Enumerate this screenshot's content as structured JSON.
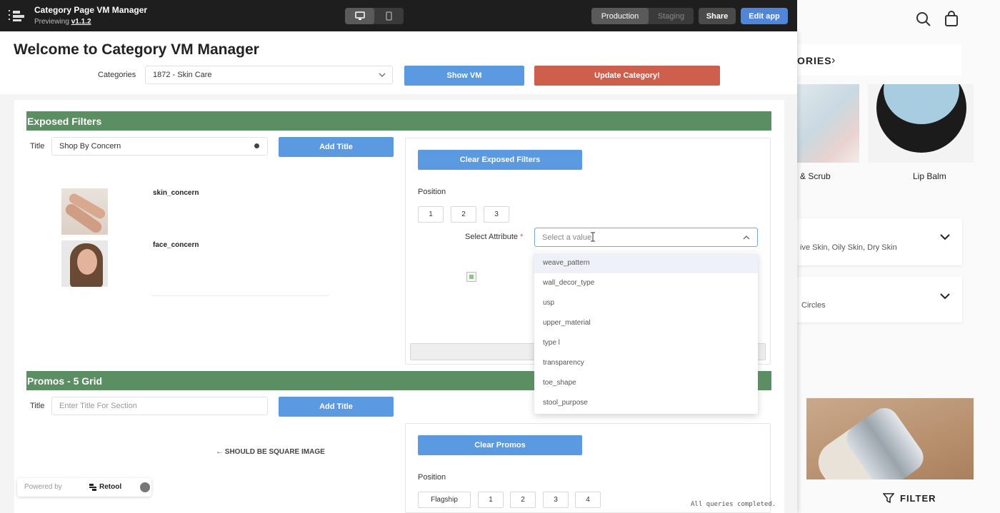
{
  "header": {
    "app_title": "Category Page VM Manager",
    "preview_prefix": "Previewing",
    "version": "v1.1.2",
    "env_production": "Production",
    "env_staging": "Staging",
    "share_label": "Share",
    "edit_label": "Edit app"
  },
  "page": {
    "title": "Welcome to Category VM Manager",
    "categories_label": "Categories",
    "category_value": "1872 - Skin Care",
    "show_vm_label": "Show VM",
    "update_category_label": "Update Category!"
  },
  "exposed_filters": {
    "section_title": "Exposed Filters",
    "title_label": "Title",
    "title_value": "Shop By Concern",
    "add_title_label": "Add Title",
    "items": [
      {
        "name": "skin_concern"
      },
      {
        "name": "face_concern"
      }
    ],
    "clear_label": "Clear Exposed Filters",
    "position_label": "Position",
    "positions": [
      "1",
      "2",
      "3"
    ],
    "select_attribute_label": "Select Attribute",
    "required_mark": "*",
    "select_placeholder": "Select a value",
    "dropdown_options": [
      "weave_pattern",
      "wall_decor_type",
      "usp",
      "upper_material",
      "type l",
      "transparency",
      "toe_shape",
      "stool_purpose"
    ]
  },
  "promos": {
    "section_title": "Promos - 5 Grid",
    "title_label": "Title",
    "title_placeholder": "Enter Title For Section",
    "add_title_label": "Add Title",
    "square_note": "← SHOULD BE SQUARE IMAGE",
    "clear_label": "Clear Promos",
    "position_label": "Position",
    "positions": [
      "Flagship",
      "1",
      "2",
      "3",
      "4"
    ]
  },
  "footer": {
    "powered_by": "Powered by",
    "brand": "Retool",
    "status": "All queries completed."
  },
  "storefront": {
    "categories_fragment": "ORIES",
    "product_labels": [
      "& Scrub",
      "Lip Balm"
    ],
    "accordion_1": "ive Skin, Oily Skin, Dry Skin",
    "accordion_2": "Circles",
    "filter_label": "FILTER"
  },
  "colors": {
    "section_green": "#5b8e63",
    "primary_blue": "#5b9ae0",
    "danger_red": "#cf5f4d",
    "topbar": "#1e1e1e"
  }
}
